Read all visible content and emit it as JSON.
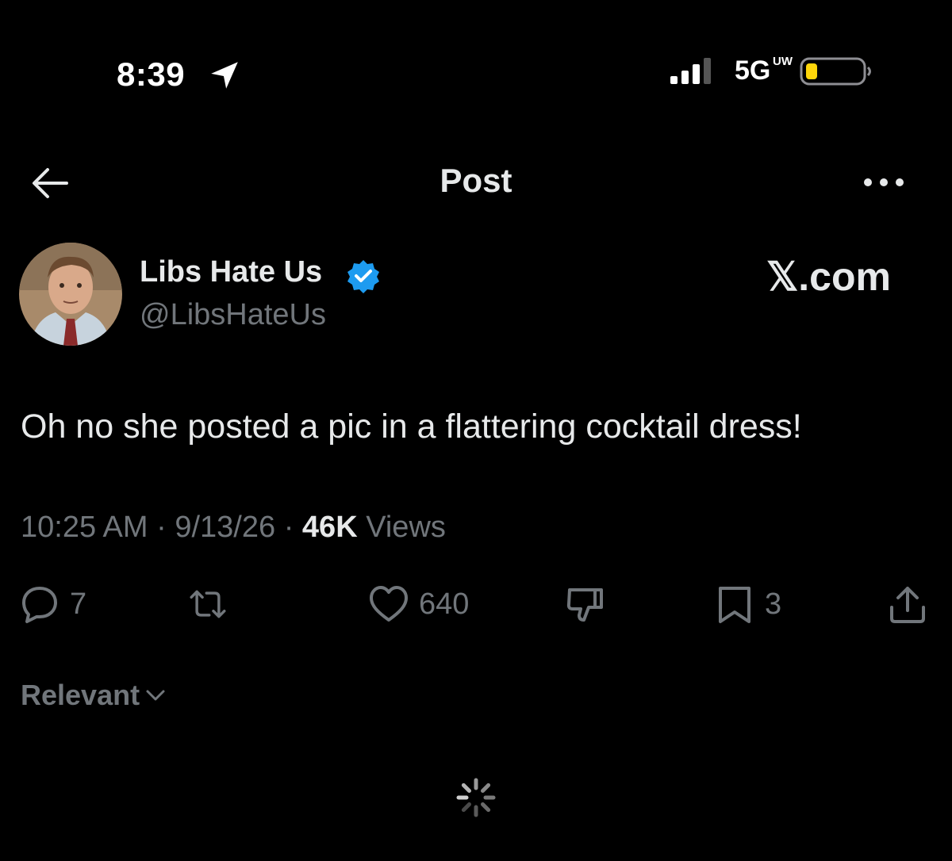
{
  "status_bar": {
    "time": "8:39",
    "network": "5G",
    "network_sup": "UW",
    "battery_color": "#ffd60a"
  },
  "header": {
    "title": "Post"
  },
  "post": {
    "author_name": "Libs Hate Us",
    "author_handle": "@LibsHateUs",
    "brand": "𝕏.com",
    "text": "Oh no she posted a pic in a flattering cocktail dress!",
    "time": "10:25 AM",
    "date": "9/13/26",
    "views_count": "46K",
    "views_label": "Views",
    "verified_color": "#1d9bf0"
  },
  "actions": {
    "replies": "7",
    "likes": "640",
    "bookmarks": "3"
  },
  "sort": {
    "label": "Relevant"
  },
  "icons": [
    "location-arrow-icon",
    "signal-icon",
    "battery-icon",
    "back-arrow-icon",
    "more-icon",
    "verified-badge-icon",
    "reply-icon",
    "retweet-icon",
    "like-icon",
    "dislike-icon",
    "bookmark-icon",
    "share-icon",
    "chevron-down-icon",
    "loading-spinner-icon"
  ]
}
